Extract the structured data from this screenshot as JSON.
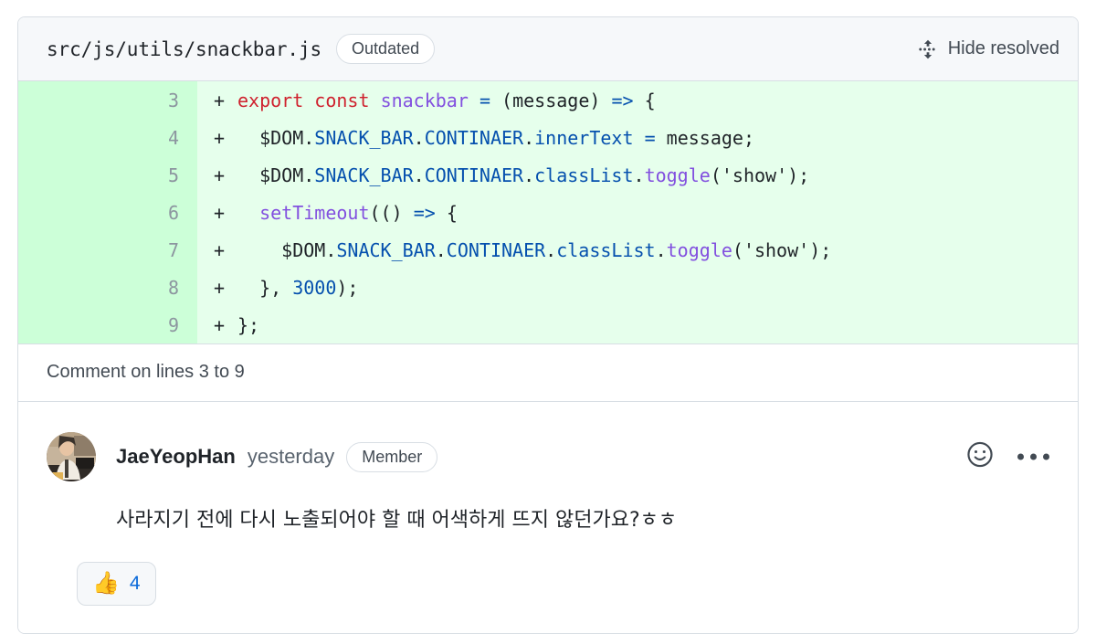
{
  "diff_header": {
    "file_path": "src/js/utils/snackbar.js",
    "status_badge": "Outdated",
    "hide_resolved_label": "Hide resolved",
    "fold_icon": "fold-icon"
  },
  "diff": {
    "lines": [
      {
        "number": "3",
        "marker": "+",
        "tokens": [
          {
            "t": "plain",
            "s": ""
          },
          {
            "t": "kw",
            "s": "export"
          },
          {
            "t": "plain",
            "s": " "
          },
          {
            "t": "kw",
            "s": "const"
          },
          {
            "t": "plain",
            "s": " "
          },
          {
            "t": "fn",
            "s": "snackbar"
          },
          {
            "t": "plain",
            "s": " "
          },
          {
            "t": "op",
            "s": "="
          },
          {
            "t": "plain",
            "s": " (message) "
          },
          {
            "t": "op",
            "s": "=>"
          },
          {
            "t": "plain",
            "s": " {"
          }
        ]
      },
      {
        "number": "4",
        "marker": "+",
        "tokens": [
          {
            "t": "plain",
            "s": "  $DOM."
          },
          {
            "t": "var",
            "s": "SNACK_BAR"
          },
          {
            "t": "plain",
            "s": "."
          },
          {
            "t": "var",
            "s": "CONTINAER"
          },
          {
            "t": "plain",
            "s": "."
          },
          {
            "t": "prop",
            "s": "innerText"
          },
          {
            "t": "plain",
            "s": " "
          },
          {
            "t": "op",
            "s": "="
          },
          {
            "t": "plain",
            "s": " message;"
          }
        ]
      },
      {
        "number": "5",
        "marker": "+",
        "tokens": [
          {
            "t": "plain",
            "s": "  $DOM."
          },
          {
            "t": "var",
            "s": "SNACK_BAR"
          },
          {
            "t": "plain",
            "s": "."
          },
          {
            "t": "var",
            "s": "CONTINAER"
          },
          {
            "t": "plain",
            "s": "."
          },
          {
            "t": "prop",
            "s": "classList"
          },
          {
            "t": "plain",
            "s": "."
          },
          {
            "t": "fn",
            "s": "toggle"
          },
          {
            "t": "plain",
            "s": "("
          },
          {
            "t": "str",
            "s": "'show'"
          },
          {
            "t": "plain",
            "s": ");"
          }
        ]
      },
      {
        "number": "6",
        "marker": "+",
        "tokens": [
          {
            "t": "plain",
            "s": "  "
          },
          {
            "t": "fn",
            "s": "setTimeout"
          },
          {
            "t": "plain",
            "s": "(() "
          },
          {
            "t": "op",
            "s": "=>"
          },
          {
            "t": "plain",
            "s": " {"
          }
        ]
      },
      {
        "number": "7",
        "marker": "+",
        "tokens": [
          {
            "t": "plain",
            "s": "    $DOM."
          },
          {
            "t": "var",
            "s": "SNACK_BAR"
          },
          {
            "t": "plain",
            "s": "."
          },
          {
            "t": "var",
            "s": "CONTINAER"
          },
          {
            "t": "plain",
            "s": "."
          },
          {
            "t": "prop",
            "s": "classList"
          },
          {
            "t": "plain",
            "s": "."
          },
          {
            "t": "fn",
            "s": "toggle"
          },
          {
            "t": "plain",
            "s": "("
          },
          {
            "t": "str",
            "s": "'show'"
          },
          {
            "t": "plain",
            "s": ");"
          }
        ]
      },
      {
        "number": "8",
        "marker": "+",
        "tokens": [
          {
            "t": "plain",
            "s": "  }, "
          },
          {
            "t": "num",
            "s": "3000"
          },
          {
            "t": "plain",
            "s": ");"
          }
        ]
      },
      {
        "number": "9",
        "marker": "+",
        "tokens": [
          {
            "t": "plain",
            "s": "};"
          }
        ]
      }
    ]
  },
  "comment_on_lines": "Comment on lines 3 to 9",
  "comment": {
    "author": "JaeYeopHan",
    "timestamp": "yesterday",
    "role_badge": "Member",
    "body": "사라지기 전에 다시 노출되어야 할 때 어색하게 뜨지 않던가요?ㅎㅎ",
    "avatar_alt": "JaeYeopHan avatar",
    "actions": {
      "add_reaction": "smiley-icon",
      "more_options": "kebab-menu-icon"
    }
  },
  "reactions": [
    {
      "emoji": "👍",
      "count": "4"
    }
  ],
  "colors": {
    "diff_add_bg": "#e6ffec",
    "diff_add_gutter": "#ccffd8",
    "header_bg": "#f6f8fa",
    "border": "#d8dee4",
    "link_blue": "#0969da",
    "keyword_red": "#cf222e",
    "function_purple": "#8250df",
    "variable_blue": "#0550ae",
    "text": "#1f2328",
    "muted_text": "#59636e"
  }
}
